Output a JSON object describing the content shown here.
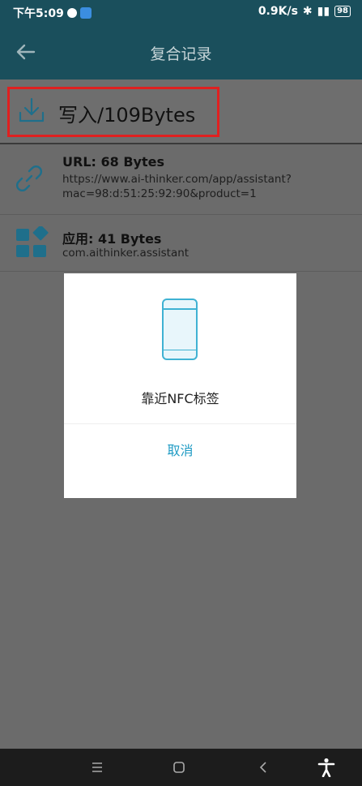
{
  "status_bar": {
    "time": "下午5:09",
    "speed": "0.9K/s",
    "battery": "98"
  },
  "toolbar": {
    "title": "复合记录"
  },
  "write": {
    "label": "写入/109Bytes"
  },
  "records": [
    {
      "title": "URL: 68 Bytes",
      "body": "https://www.ai-thinker.com/app/assistant?mac=98:d:51:25:92:90&product=1",
      "icon": "link-icon"
    },
    {
      "title": "应用: 41 Bytes",
      "body": "com.aithinker.assistant",
      "icon": "apps-icon"
    }
  ],
  "dialog": {
    "message": "靠近NFC标签",
    "cancel_label": "取消"
  },
  "colors": {
    "toolbar_bg": "#1a4f5c",
    "accent": "#1f9bc4",
    "highlight_border": "#e02020",
    "icon_blue": "#1f6f8b"
  }
}
